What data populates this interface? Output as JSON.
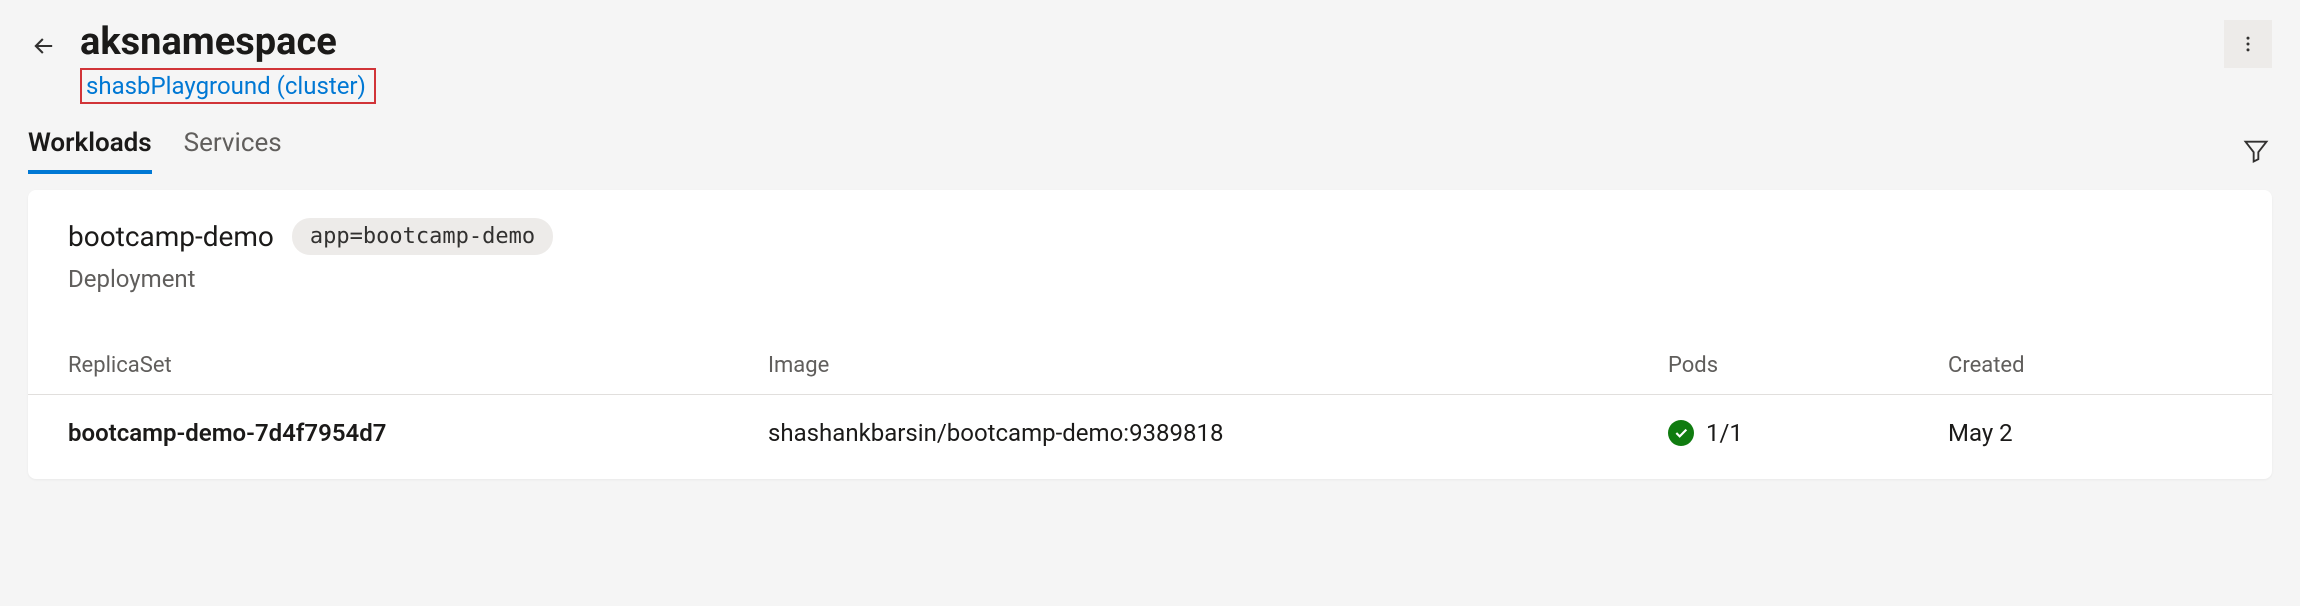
{
  "header": {
    "title": "aksnamespace",
    "cluster_link": "shasbPlayground (cluster)"
  },
  "tabs": {
    "workloads": "Workloads",
    "services": "Services"
  },
  "workload": {
    "name": "bootcamp-demo",
    "label_badge": "app=bootcamp-demo",
    "kind": "Deployment",
    "columns": {
      "replicaset": "ReplicaSet",
      "image": "Image",
      "pods": "Pods",
      "created": "Created"
    },
    "row": {
      "replicaset": "bootcamp-demo-7d4f7954d7",
      "image": "shashankbarsin/bootcamp-demo:9389818",
      "pods": "1/1",
      "created": "May 2"
    }
  }
}
